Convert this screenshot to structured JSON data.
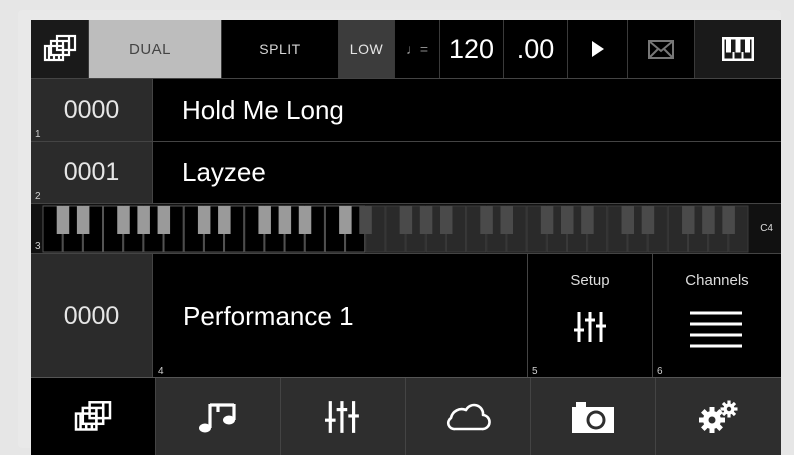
{
  "toolbar": {
    "dual_label": "DUAL",
    "split_label": "SPLIT",
    "low_label": "LOW",
    "tempo_symbol": "♩=",
    "tempo_integer": "120",
    "tempo_fraction": ".00"
  },
  "rows": [
    {
      "index": "1",
      "number": "0000",
      "name": "Hold Me Long"
    },
    {
      "index": "2",
      "number": "0001",
      "name": "Layzee"
    }
  ],
  "keyboard": {
    "index": "3",
    "octave_label": "C4",
    "active_split": 0.44
  },
  "performance": {
    "number": "0000",
    "name": "Performance 1",
    "index": "4",
    "setup": {
      "label": "Setup",
      "index": "5"
    },
    "channels": {
      "label": "Channels",
      "index": "6"
    }
  },
  "colors": {
    "screen_bg": "#000000",
    "panel_dark": "#2b2b2b",
    "toolbar_light": "#bdbdbd",
    "text": "#ffffff",
    "key_white_active": "#000000",
    "key_white_inactive": "#2a2a2a",
    "key_black_active": "#9a9a9a",
    "key_black_inactive": "#4a4a4a"
  },
  "icons": {
    "toolbar": [
      "keyboard-stack-icon",
      "quarter-note-icon",
      "play-icon",
      "mail-icon",
      "piano-keys-icon"
    ],
    "nav": [
      "keyboard-stack-icon",
      "music-notes-icon",
      "mixer-sliders-icon",
      "cloud-icon",
      "camera-icon",
      "gears-icon"
    ]
  }
}
